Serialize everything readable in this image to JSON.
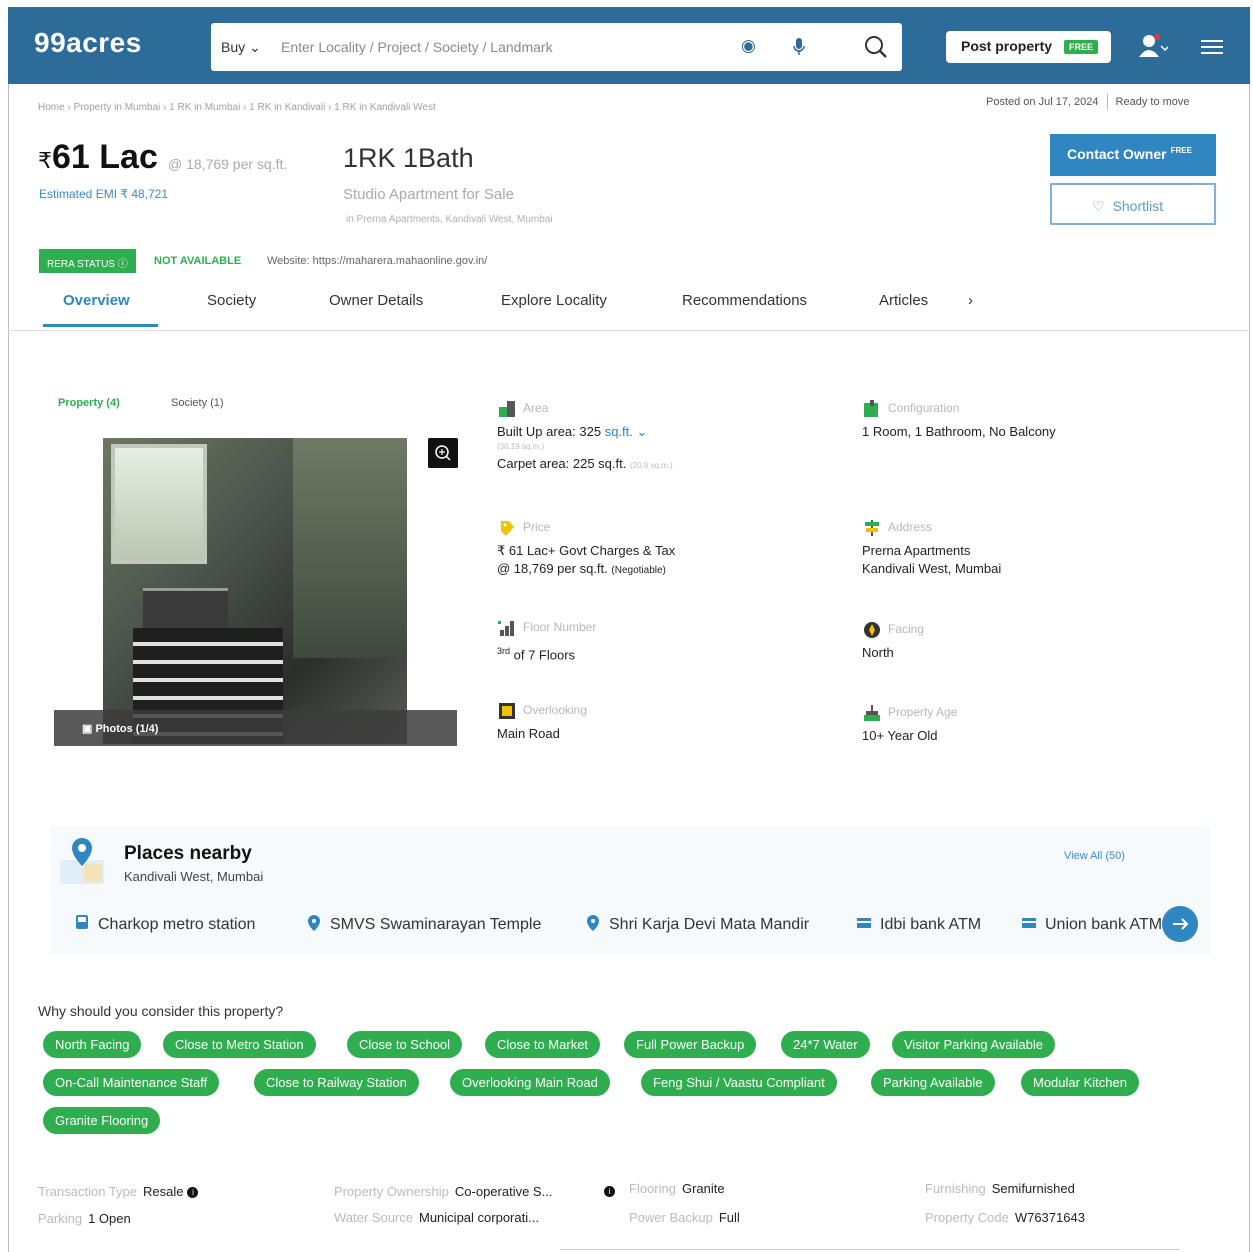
{
  "header": {
    "logo": "99acres",
    "search_type": "Buy",
    "search_placeholder": "Enter Locality / Project / Society / Landmark",
    "post_property": "Post property",
    "post_free_badge": "FREE",
    "brand_color": "#2d6c98"
  },
  "breadcrumb": "Home › Property in Mumbai › 1 RK in Mumbai › 1 RK in Kandivali › 1 RK in Kandivali West",
  "posted_on": "Posted on Jul 17, 2024",
  "ready_status": "Ready to move",
  "listing": {
    "currency": "₹",
    "price": "61 Lac",
    "per_sqft": "@ 18,769 per sq.ft.",
    "emi": "Estimated EMI ₹ 48,721",
    "title": "1RK 1Bath",
    "subtitle": "Studio Apartment for Sale",
    "address_line": "in Prerna Apartments, Kandivali West, Mumbai",
    "contact_owner": "Contact Owner",
    "contact_free": "FREE",
    "shortlist": "Shortlist",
    "rera_status": "RERA STATUS",
    "rera_value": "NOT AVAILABLE",
    "website": "Website: https://maharera.mahaonline.gov.in/"
  },
  "tabs": [
    "Overview",
    "Society",
    "Owner Details",
    "Explore Locality",
    "Recommendations",
    "Articles"
  ],
  "tabs_more": "›",
  "gallery": {
    "property_tab": "Property (4)",
    "society_tab": "Society (1)",
    "photos_label": "Photos (1/4)"
  },
  "details": {
    "area_label": "Area",
    "built_up": "Built Up area: 325",
    "built_up_unit": "sq.ft.",
    "built_up_sqm": "(30.19 sq.m.)",
    "carpet": "Carpet area: 225 sq.ft.",
    "carpet_sqm": "(20.9 sq.m.)",
    "config_label": "Configuration",
    "config_value": "1 Room, 1 Bathroom, No Balcony",
    "price_label": "Price",
    "price_line1": "₹ 61 Lac+ Govt Charges & Tax",
    "price_line2": "@ 18,769 per sq.ft.",
    "price_negotiable": "(Negotiable)",
    "address_label": "Address",
    "address_line1": "Prerna Apartments",
    "address_line2": "Kandivali West, Mumbai",
    "floor_label": "Floor Number",
    "floor_sup": "3rd",
    "floor_value": "of 7 Floors",
    "facing_label": "Facing",
    "facing_value": "North",
    "overlooking_label": "Overlooking",
    "overlooking_value": "Main Road",
    "age_label": "Property Age",
    "age_value": "10+ Year Old"
  },
  "places": {
    "title": "Places nearby",
    "subtitle": "Kandivali West, Mumbai",
    "view_all": "View All (50)",
    "items": [
      "Charkop metro station",
      "SMVS Swaminarayan Temple",
      "Shri Karja Devi Mata Mandir",
      "Idbi bank ATM",
      "Union bank ATM"
    ]
  },
  "why": {
    "title": "Why should you consider this property?",
    "chips": [
      "North Facing",
      "Close to Metro Station",
      "Close to School",
      "Close to Market",
      "Full Power Backup",
      "24*7 Water",
      "Visitor Parking Available",
      "On-Call Maintenance Staff",
      "Close to Railway Station",
      "Overlooking Main Road",
      "Feng Shui / Vaastu Compliant",
      "Parking Available",
      "Modular Kitchen",
      "Granite Flooring"
    ],
    "chip_color": "#2fae4f"
  },
  "overview": {
    "transaction_key": "Transaction Type",
    "transaction_val": "Resale",
    "ownership_key": "Property Ownership",
    "ownership_val": "Co-operative S...",
    "flooring_key": "Flooring",
    "flooring_val": "Granite",
    "furnishing_key": "Furnishing",
    "furnishing_val": "Semifurnished",
    "parking_key": "Parking",
    "parking_val": "1 Open",
    "water_key": "Water Source",
    "water_val": "Municipal corporati...",
    "power_key": "Power Backup",
    "power_val": "Full",
    "code_key": "Property Code",
    "code_val": "W76371643"
  }
}
